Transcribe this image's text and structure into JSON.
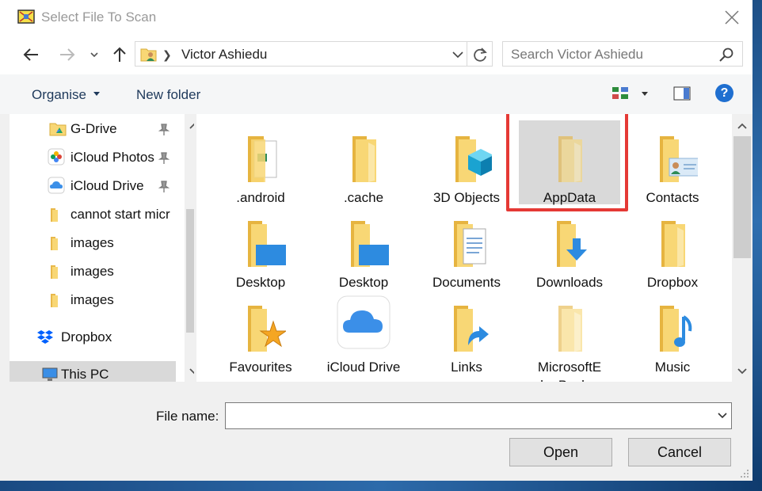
{
  "window": {
    "title": "Select File To Scan"
  },
  "address": {
    "path": "Victor Ashiedu",
    "search_placeholder": "Search Victor Ashiedu"
  },
  "toolbar": {
    "organise_label": "Organise",
    "new_folder_label": "New folder",
    "help_label": "?"
  },
  "nav_pane": {
    "items": [
      {
        "label": "G-Drive",
        "icon": "google-drive-icon",
        "pinned": true
      },
      {
        "label": "iCloud Photos",
        "icon": "icloud-photos-icon",
        "pinned": true
      },
      {
        "label": "iCloud Drive",
        "icon": "icloud-drive-icon",
        "pinned": true
      },
      {
        "label": "cannot start micr",
        "icon": "folder-icon",
        "pinned": false
      },
      {
        "label": "images",
        "icon": "folder-icon",
        "pinned": false
      },
      {
        "label": "images",
        "icon": "folder-icon",
        "pinned": false
      },
      {
        "label": "images",
        "icon": "folder-icon",
        "pinned": false
      },
      {
        "label": "Dropbox",
        "icon": "dropbox-icon",
        "pinned": false
      },
      {
        "label": "This PC",
        "icon": "computer-icon",
        "pinned": false,
        "selected": true
      }
    ]
  },
  "content": {
    "items": [
      {
        "label": ".android",
        "icon": "document-folder-icon"
      },
      {
        "label": ".cache",
        "icon": "folder-icon"
      },
      {
        "label": "3D Objects",
        "icon": "3d-objects-folder-icon"
      },
      {
        "label": "AppData",
        "icon": "hidden-folder-icon",
        "selected": true,
        "highlighted": true
      },
      {
        "label": "Contacts",
        "icon": "contacts-folder-icon"
      },
      {
        "label": "Desktop",
        "icon": "desktop-folder-icon"
      },
      {
        "label": "Desktop",
        "icon": "desktop-folder-icon"
      },
      {
        "label": "Documents",
        "icon": "documents-folder-icon"
      },
      {
        "label": "Downloads",
        "icon": "downloads-folder-icon"
      },
      {
        "label": "Dropbox",
        "icon": "folder-icon"
      },
      {
        "label": "Favourites",
        "icon": "favourites-folder-icon"
      },
      {
        "label": "iCloud Drive",
        "icon": "icloud-app-icon"
      },
      {
        "label": "Links",
        "icon": "links-folder-icon"
      },
      {
        "label": "MicrosoftEdgeBackup",
        "label_lines": [
          "MicrosoftE",
          "dgeBackup"
        ],
        "icon": "hidden-folder-icon"
      },
      {
        "label": "Music",
        "icon": "music-folder-icon"
      }
    ]
  },
  "file_name": {
    "label": "File name:",
    "value": ""
  },
  "buttons": {
    "open_label": "Open",
    "cancel_label": "Cancel"
  },
  "colors": {
    "accent": "#1f6fd0",
    "highlight_border": "#e53935",
    "folder_yellow": "#f8d775",
    "selection_bg": "#d9d9d9"
  }
}
